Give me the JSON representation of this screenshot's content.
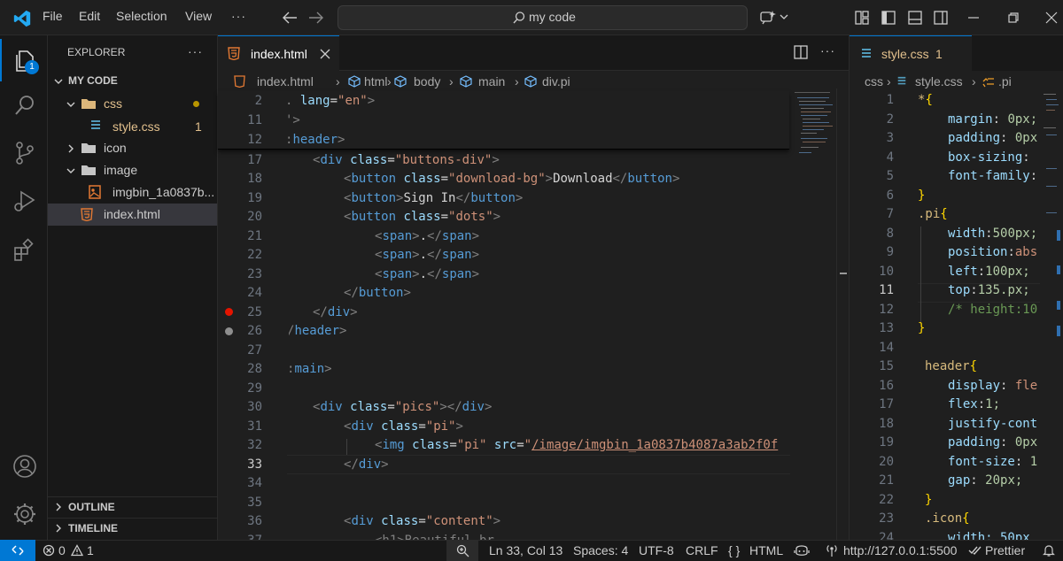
{
  "titlebar": {
    "menu": [
      "File",
      "Edit",
      "Selection",
      "View"
    ],
    "more": "···",
    "search_text": "my code"
  },
  "activitybar": {
    "explorer_badge": "1"
  },
  "sidebar": {
    "title": "EXPLORER",
    "more": "···",
    "section": "MY CODE",
    "tree": [
      {
        "label": "css"
      },
      {
        "label": "style.css",
        "badge": "1"
      },
      {
        "label": "icon"
      },
      {
        "label": "image"
      },
      {
        "label": "imgbin_1a0837b..."
      },
      {
        "label": "index.html"
      }
    ],
    "outline": "OUTLINE",
    "timeline": "TIMELINE"
  },
  "left_editor": {
    "tab_label": "index.html",
    "breadcrumb": [
      "index.html",
      "html",
      "body",
      "main",
      "div.pi"
    ],
    "sticky_lines": [
      "2",
      "11",
      "12"
    ],
    "line_numbers": [
      "17",
      "18",
      "19",
      "20",
      "21",
      "22",
      "23",
      "24",
      "25",
      "26",
      "27",
      "28",
      "29",
      "30",
      "31",
      "32",
      "33",
      "34",
      "35",
      "36",
      "37"
    ],
    "code": {
      "s2a": ". ",
      "s2b": "lang",
      "s2c": "=",
      "s2d": "\"en\"",
      "s2e": ">",
      "s11": "'>",
      "s12a": ":",
      "s12b": "header",
      "s12c": ">",
      "l17a": "<",
      "l17b": "div",
      "l17c": "class",
      "l17d": "=",
      "l17e": "\"buttons-div\"",
      "l17f": ">",
      "l18a": "<",
      "l18b": "button",
      "l18c": "class",
      "l18d": "=",
      "l18e": "\"download-bg\"",
      "l18f": ">",
      "l18g": "Download",
      "l18h": "</",
      "l18i": "button",
      "l18j": ">",
      "l19a": "<",
      "l19b": "button",
      "l19c": ">",
      "l19d": "Sign In",
      "l19e": "</",
      "l19f": "button",
      "l19g": ">",
      "l20a": "<",
      "l20b": "button",
      "l20c": "class",
      "l20d": "=",
      "l20e": "\"dots\"",
      "l20f": ">",
      "span_open": "<",
      "span_name": "span",
      "span_close": ">",
      "span_text": ".",
      "span_end_open": "</",
      "span_end_close": ">",
      "l24a": "</",
      "l24b": "button",
      "l24c": ">",
      "l25a": "</",
      "l25b": "div",
      "l25c": ">",
      "l26a": "/",
      "l26b": "header",
      "l26c": ">",
      "l28a": ":",
      "l28b": "main",
      "l28c": ">",
      "l30a": "<",
      "l30b": "div",
      "l30c": "class",
      "l30d": "=",
      "l30e": "\"pics\"",
      "l30f": "></",
      "l30g": "div",
      "l30h": ">",
      "l31a": "<",
      "l31b": "div",
      "l31c": "class",
      "l31d": "=",
      "l31e": "\"pi\"",
      "l31f": ">",
      "l32a": "<",
      "l32b": "img",
      "l32c": "class",
      "l32d": "=",
      "l32e": "\"pi\"",
      "l32f": "src",
      "l32g": "=",
      "l32h": "\"",
      "l32i": "/image/imgbin_1a0837b4087a3ab2f0f",
      "l33a": "</",
      "l33b": "div",
      "l33c": ">",
      "l36a": "<",
      "l36b": "div",
      "l36c": "class",
      "l36d": "=",
      "l36e": "\"content\"",
      "l36f": ">",
      "l37": "<h1>Beautiful br"
    }
  },
  "right_editor": {
    "tab_label": "style.css",
    "tab_badge": "1",
    "breadcrumb": [
      "css",
      "style.css",
      ".pi"
    ],
    "line_numbers": [
      "1",
      "2",
      "3",
      "4",
      "5",
      "6",
      "7",
      "8",
      "9",
      "10",
      "11",
      "12",
      "13",
      "14",
      "15",
      "16",
      "17",
      "18",
      "19",
      "20",
      "21",
      "22",
      "23",
      "24"
    ],
    "code": {
      "r1": "*",
      "r1b": "{",
      "r2p": "margin",
      "r2v": "0px;",
      "r3p": "padding",
      "r3v": "0px",
      "r4p": "box-sizing",
      "r5p": "font-family",
      "r6": "}",
      "r7": ".pi",
      "r7b": "{",
      "r8p": "width",
      "r8v": "500px;",
      "r9p": "position",
      "r9v": "abs",
      "r10p": "left",
      "r10v": "100px;",
      "r11p": "top",
      "r11v": "135.px;",
      "r12": "/* height:10",
      "r13": "}",
      "r15": "header",
      "r15b": "{",
      "r16p": "display",
      "r16v": "fle",
      "r17p": "flex",
      "r17v": "1;",
      "r18p": "justify-cont",
      "r19p": "padding",
      "r19v": "0px",
      "r20p": "font-size",
      "r20v": "1",
      "r21p": "gap",
      "r21v": "20px;",
      "r22": "}",
      "r23": ".icon",
      "r23b": "{",
      "r24": "width: 50px"
    }
  },
  "statusbar": {
    "errors": "0",
    "warnings": "1",
    "position": "Ln 33, Col 13",
    "spaces": "Spaces: 4",
    "encoding": "UTF-8",
    "eol": "CRLF",
    "language": "HTML",
    "language_braces": "{ }",
    "live_server": "http://127.0.0.1:5500",
    "prettier": "Prettier"
  },
  "colors": {
    "accent": "#0078d4",
    "html_icon": "#e37933",
    "css_icon": "#519aba",
    "warning_text": "#e2c08d",
    "breakpoint": "#e51400"
  }
}
